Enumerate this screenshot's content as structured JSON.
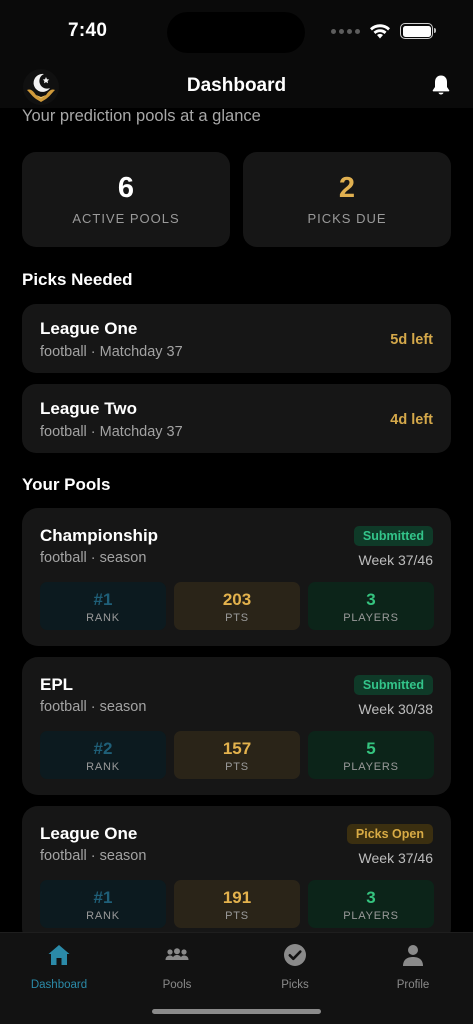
{
  "status": {
    "time": "7:40"
  },
  "header": {
    "title": "Dashboard"
  },
  "subtitle": "Your prediction pools at a glance",
  "stats": [
    {
      "value": "6",
      "label": "ACTIVE POOLS",
      "color": "#ffffff"
    },
    {
      "value": "2",
      "label": "PICKS DUE",
      "color": "#e0b050"
    }
  ],
  "picks_needed": {
    "title": "Picks Needed",
    "items": [
      {
        "name": "League One",
        "meta": "football · Matchday 37",
        "due": "5d left"
      },
      {
        "name": "League Two",
        "meta": "football · Matchday 37",
        "due": "4d left"
      }
    ]
  },
  "your_pools": {
    "title": "Your Pools",
    "items": [
      {
        "name": "Championship",
        "meta": "football · season",
        "badge": "Submitted",
        "badge_type": "submitted",
        "week": "Week 37/46",
        "rank": "#1",
        "pts": "203",
        "players": "3"
      },
      {
        "name": "EPL",
        "meta": "football · season",
        "badge": "Submitted",
        "badge_type": "submitted",
        "week": "Week 30/38",
        "rank": "#2",
        "pts": "157",
        "players": "5"
      },
      {
        "name": "League One",
        "meta": "football · season",
        "badge": "Picks Open",
        "badge_type": "open",
        "week": "Week 37/46",
        "rank": "#1",
        "pts": "191",
        "players": "3"
      }
    ],
    "metric_labels": {
      "rank": "RANK",
      "pts": "PTS",
      "players": "PLAYERS"
    }
  },
  "tabs": [
    {
      "label": "Dashboard",
      "icon": "home-icon",
      "active": true
    },
    {
      "label": "Pools",
      "icon": "people-icon",
      "active": false
    },
    {
      "label": "Picks",
      "icon": "check-circle-icon",
      "active": false
    },
    {
      "label": "Profile",
      "icon": "person-icon",
      "active": false
    }
  ],
  "colors": {
    "accent": "#2b8aa8",
    "gold": "#d4a84a",
    "green": "#35c47f",
    "card": "#161616"
  }
}
